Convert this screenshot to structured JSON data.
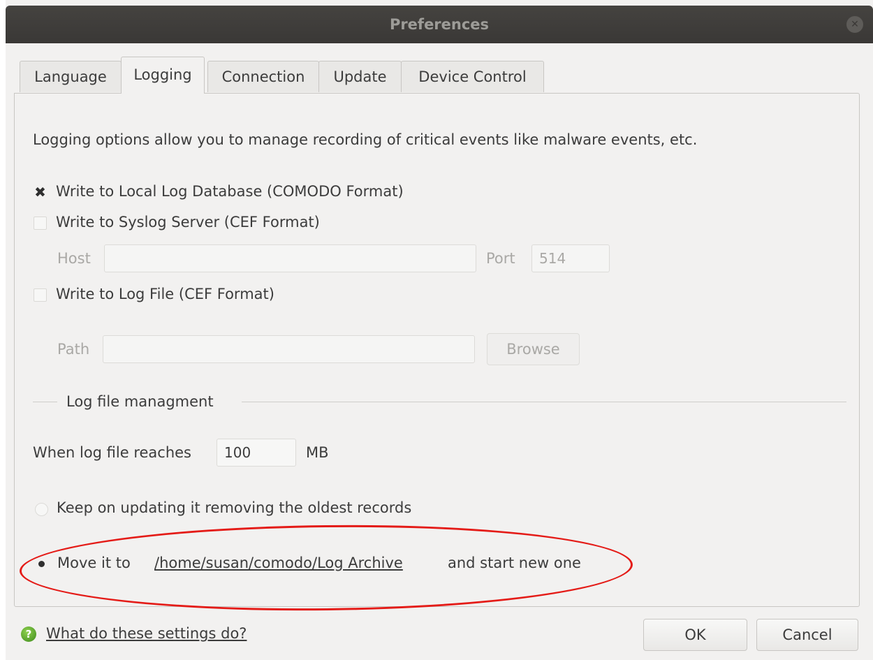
{
  "window": {
    "title": "Preferences"
  },
  "tabs": [
    {
      "label": "Language"
    },
    {
      "label": "Logging"
    },
    {
      "label": "Connection"
    },
    {
      "label": "Update"
    },
    {
      "label": "Device Control"
    }
  ],
  "logging": {
    "description": "Logging options allow you to manage recording of critical events like malware events, etc.",
    "local_db_label": "Write to Local Log Database (COMODO Format)",
    "local_db_checked": true,
    "syslog_label": "Write to Syslog Server (CEF Format)",
    "syslog_checked": false,
    "host_label": "Host",
    "host_value": "",
    "port_label": "Port",
    "port_value": "514",
    "logfile_label": "Write to Log File (CEF Format)",
    "logfile_checked": false,
    "path_label": "Path",
    "path_value": "",
    "browse_label": "Browse"
  },
  "management": {
    "section_title": "Log file managment",
    "size_label": "When log file reaches",
    "size_value": "100",
    "size_unit": "MB",
    "option_keep": "Keep on updating it removing the oldest records",
    "option_move_prefix": "Move it to",
    "option_move_path": "/home/susan/comodo/Log Archive",
    "option_move_suffix": "and start new one",
    "selected_option": "move"
  },
  "footer": {
    "help_link": "What do these settings do?",
    "ok_label": "OK",
    "cancel_label": "Cancel"
  }
}
